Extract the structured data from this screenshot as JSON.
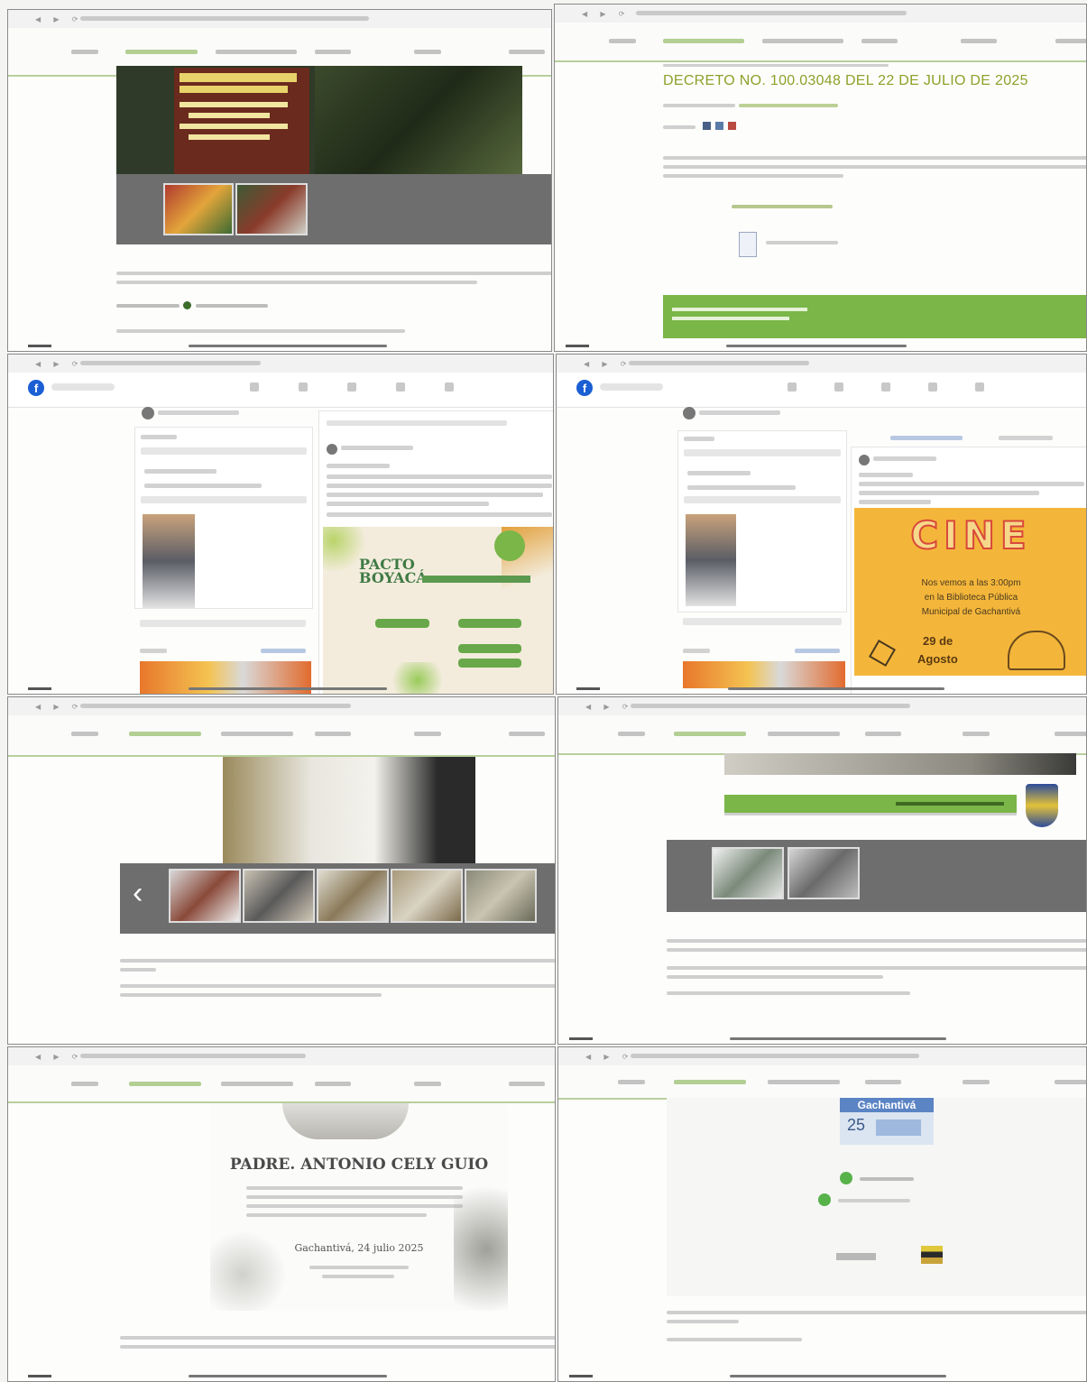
{
  "panel_decreto": {
    "title": "DECRETO NO. 100.03048 DEL 22 DE JULIO DE 2025"
  },
  "panel_cine": {
    "title": "CINE",
    "line1": "Nos vemos a las 3:00pm",
    "line2": "en la Biblioteca Pública",
    "line3": "Municipal de Gachantivá",
    "date_day": "29 de",
    "date_month": "Agosto"
  },
  "panel_pacto": {
    "title_line1": "PACTO",
    "title_line2": "BOYACÁ"
  },
  "panel_padre": {
    "title": "PADRE. ANTONIO CELY GUIO",
    "place_date": "Gachantivá, 24 julio 2025"
  },
  "panel_event": {
    "town": "Gachantivá",
    "day": "25"
  },
  "colors": {
    "green": "#7ab648",
    "title_olive": "#8fa02a",
    "cine_bg": "#f4b63a",
    "cine_red": "#d9483b",
    "gray_strip": "#6e6e6e"
  }
}
